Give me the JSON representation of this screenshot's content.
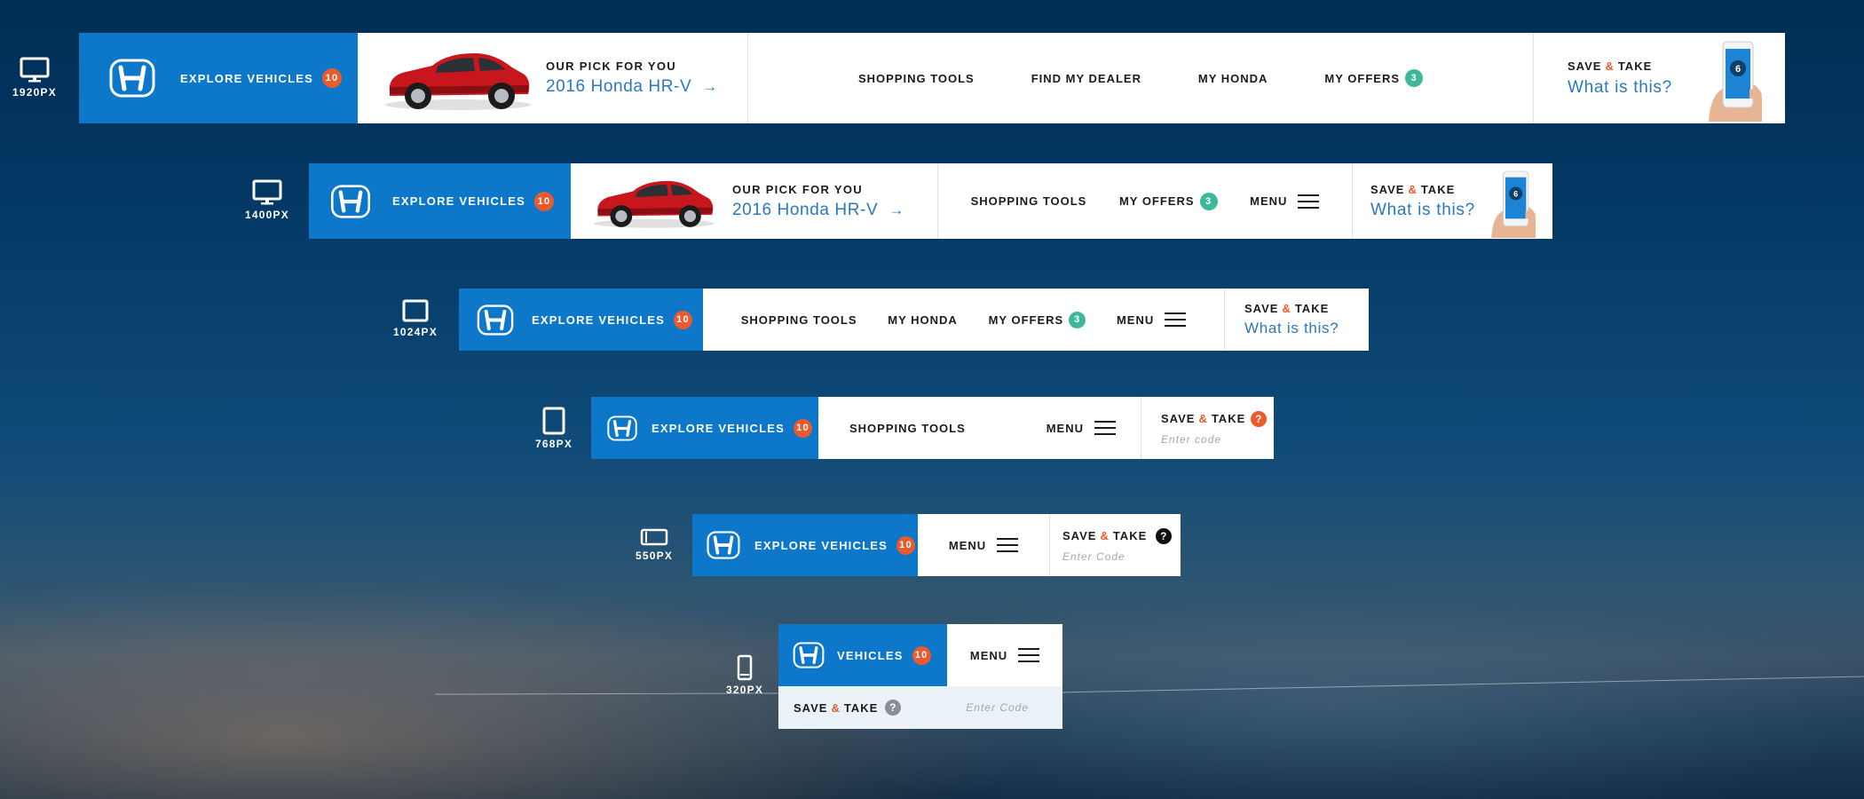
{
  "colors": {
    "honda_blue": "#0d77c9",
    "accent_orange": "#ea5a2c",
    "offers_green": "#3db89a",
    "link_blue": "#2a78bf",
    "dark_text": "#1b1b1b"
  },
  "icons": [
    "monitor-icon",
    "tablet-landscape-icon",
    "tablet-portrait-icon",
    "phone-landscape-icon",
    "phone-portrait-icon",
    "honda-logo-icon",
    "hamburger-menu-icon",
    "arrow-right-icon",
    "question-icon",
    "car-image",
    "phone-hand-image"
  ],
  "rows": {
    "r1920": {
      "device_label": "1920PX",
      "explore_label": "EXPLORE VEHICLES",
      "explore_count": "10",
      "pick_label": "OUR PICK FOR YOU",
      "pick_model": "2016 Honda HR-V",
      "arrow": "→",
      "nav": {
        "shopping_tools": "SHOPPING TOOLS",
        "find_dealer": "FIND MY DEALER",
        "my_honda": "MY HONDA",
        "my_offers": "MY OFFERS",
        "offers_count": "3"
      },
      "save": {
        "save": "SAVE",
        "amp": "&",
        "take": "TAKE",
        "what": "What is this?",
        "phone_number": "6"
      }
    },
    "r1400": {
      "device_label": "1400PX",
      "explore_label": "EXPLORE VEHICLES",
      "explore_count": "10",
      "pick_label": "OUR PICK FOR YOU",
      "pick_model": "2016 Honda HR-V",
      "arrow": "→",
      "nav": {
        "shopping_tools": "SHOPPING TOOLS",
        "my_offers": "MY OFFERS",
        "offers_count": "3",
        "menu": "MENU"
      },
      "save": {
        "save": "SAVE",
        "amp": "&",
        "take": "TAKE",
        "what": "What is this?",
        "phone_number": "6"
      }
    },
    "r1024": {
      "device_label": "1024PX",
      "explore_label": "EXPLORE VEHICLES",
      "explore_count": "10",
      "nav": {
        "shopping_tools": "SHOPPING TOOLS",
        "my_honda": "MY HONDA",
        "my_offers": "MY OFFERS",
        "offers_count": "3",
        "menu": "MENU"
      },
      "save": {
        "save": "SAVE",
        "amp": "&",
        "take": "TAKE",
        "what": "What is this?"
      }
    },
    "r768": {
      "device_label": "768PX",
      "explore_label": "EXPLORE VEHICLES",
      "explore_count": "10",
      "nav": {
        "shopping_tools": "SHOPPING TOOLS",
        "menu": "MENU"
      },
      "save": {
        "save": "SAVE",
        "amp": "&",
        "take": "TAKE",
        "q": "?",
        "code_placeholder": "Enter code"
      }
    },
    "r550": {
      "device_label": "550PX",
      "explore_label": "EXPLORE VEHICLES",
      "explore_count": "10",
      "nav": {
        "menu": "MENU"
      },
      "save": {
        "save": "SAVE",
        "amp": "&",
        "take": "TAKE",
        "q": "?",
        "code_placeholder": "Enter Code"
      }
    },
    "r320": {
      "device_label": "320PX",
      "explore_label": "VEHICLES",
      "explore_count": "10",
      "nav": {
        "menu": "MENU"
      },
      "save": {
        "save": "SAVE",
        "amp": "&",
        "take": "TAKE",
        "q": "?",
        "code_placeholder": "Enter Code"
      }
    }
  }
}
